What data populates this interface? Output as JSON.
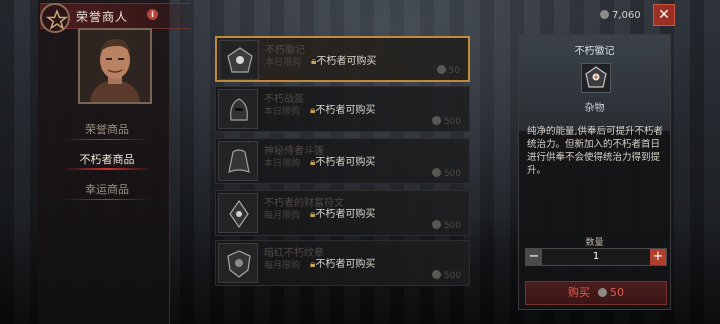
{
  "title": "荣誉商人",
  "nav": [
    {
      "label": "荣誉商品",
      "active": false
    },
    {
      "label": "不朽者商品",
      "active": true
    },
    {
      "label": "幸运商品",
      "active": false
    }
  ],
  "currency": {
    "amount": "7,060"
  },
  "items": [
    {
      "name": "不朽徽记",
      "limit": "本日限购",
      "lock_text": "不朽者可购买",
      "price": "50",
      "selected": true,
      "icon": "sigil-icon"
    },
    {
      "name": "不朽战盔",
      "limit": "本日限购",
      "lock_text": "不朽者可购买",
      "price": "500",
      "selected": false,
      "icon": "helm-icon"
    },
    {
      "name": "神秘侍者斗篷",
      "limit": "本日限购",
      "lock_text": "不朽者可购买",
      "price": "500",
      "selected": false,
      "icon": "cloak-icon"
    },
    {
      "name": "不朽者的财富符文",
      "limit": "每月限购",
      "lock_text": "不朽者可购买",
      "price": "500",
      "selected": false,
      "icon": "rune-icon"
    },
    {
      "name": "暗红不朽纹章",
      "limit": "每月限购",
      "lock_text": "不朽者可购买",
      "price": "500",
      "selected": false,
      "icon": "crest-icon"
    }
  ],
  "detail": {
    "title": "不朽徽记",
    "category": "杂物",
    "description": "纯净的能量,供奉后可提升不朽者统治力。但新加入的不朽者首日进行供奉不会使得统治力得到提升。",
    "qty_label": "数量",
    "qty_value": "1",
    "minus": "−",
    "plus": "+",
    "buy_label": "购买",
    "buy_price": "50"
  },
  "close_label": "✕",
  "colors": {
    "accent": "#c08a3a",
    "danger": "#b0402d"
  }
}
